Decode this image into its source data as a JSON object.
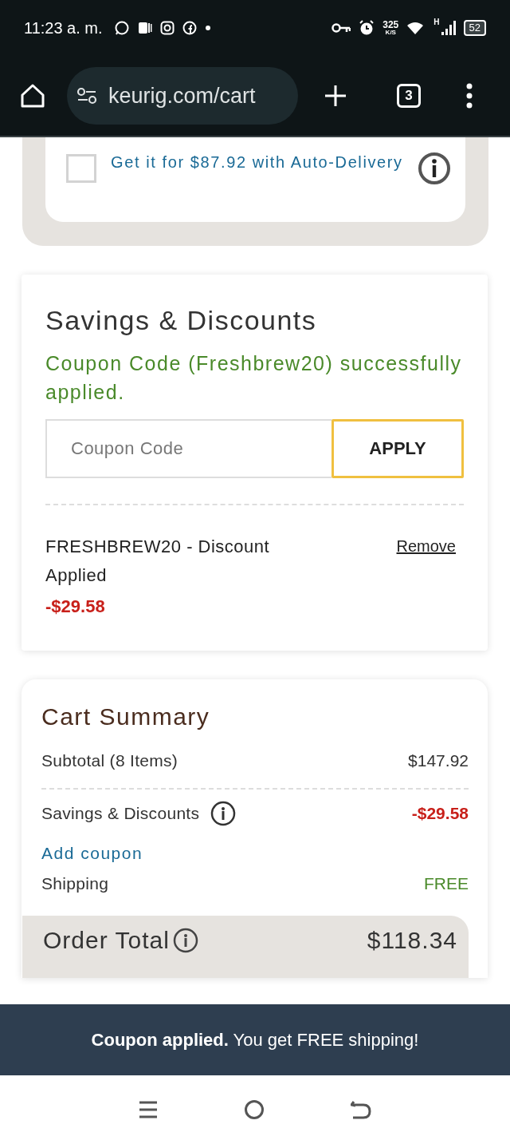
{
  "status_bar": {
    "time": "11:23 a. m.",
    "speed": "325",
    "speed_unit": "K/S",
    "network": "H",
    "battery": "52"
  },
  "browser": {
    "url": "keurig.com/cart",
    "tab_count": "3"
  },
  "auto_delivery": {
    "label": "Get it for $87.92 with Auto-Delivery",
    "checked": false
  },
  "savings": {
    "title": "Savings & Discounts",
    "message": "Coupon Code (Freshbrew20) successfully applied.",
    "coupon_field": {
      "placeholder": "Coupon Code"
    },
    "apply_button": "APPLY",
    "applied": [
      {
        "label": "FRESHBREW20 - Discount Applied",
        "amount": "-$29.58",
        "action": "Remove"
      }
    ]
  },
  "cart_summary": {
    "title": "Cart Summary",
    "rows": [
      {
        "kind": "plain",
        "label": "Subtotal (8 Items)",
        "value": "$147.92"
      },
      {
        "kind": "discount",
        "label": "Savings & Discounts",
        "value": "-$29.58"
      },
      {
        "kind": "link",
        "label": "Add coupon"
      },
      {
        "kind": "free",
        "label": "Shipping",
        "value": "FREE"
      }
    ],
    "order_total": {
      "label": "Order Total",
      "value": "$118.34"
    }
  },
  "toast": "**Coupon applied.** You get FREE shipping!"
}
